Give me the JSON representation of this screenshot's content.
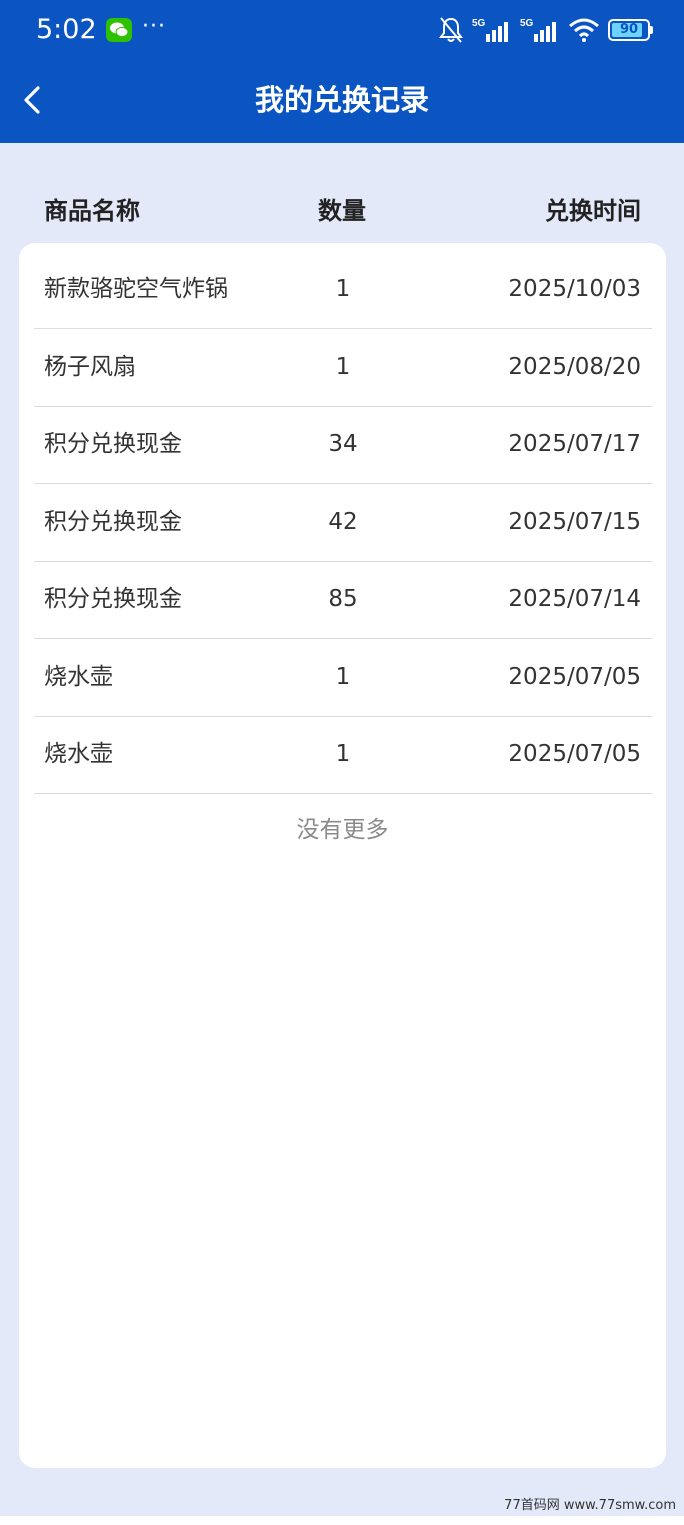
{
  "status_bar": {
    "time": "5:02",
    "more": "···",
    "network_1": "5G",
    "network_2": "5G",
    "battery": "90"
  },
  "header": {
    "title": "我的兑换记录"
  },
  "table": {
    "columns": [
      "商品名称",
      "数量",
      "兑换时间"
    ],
    "rows": [
      {
        "name": "新款骆驼空气炸锅",
        "qty": "1",
        "time": "2025/10/03"
      },
      {
        "name": "杨子风扇",
        "qty": "1",
        "time": "2025/08/20"
      },
      {
        "name": "积分兑换现金",
        "qty": "34",
        "time": "2025/07/17"
      },
      {
        "name": "积分兑换现金",
        "qty": "42",
        "time": "2025/07/15"
      },
      {
        "name": "积分兑换现金",
        "qty": "85",
        "time": "2025/07/14"
      },
      {
        "name": "烧水壶",
        "qty": "1",
        "time": "2025/07/05"
      },
      {
        "name": "烧水壶",
        "qty": "1",
        "time": "2025/07/05"
      }
    ],
    "footer": "没有更多"
  },
  "watermark": "77首码网 www.77smw.com",
  "colors": {
    "header_bg": "#0b55c2",
    "page_bg": "#e3e9f9",
    "card_bg": "#ffffff"
  }
}
